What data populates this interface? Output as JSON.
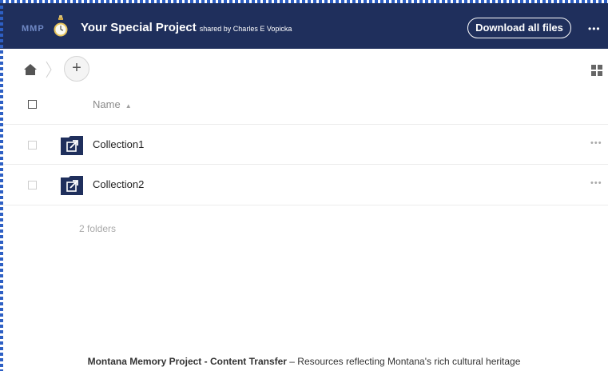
{
  "header": {
    "logo_text": "MMP",
    "title": "Your Special Project",
    "shared_by": "shared by Charles E Vopicka",
    "download_label": "Download all files",
    "more_label": "•••",
    "logo_icon": "watch-icon"
  },
  "toolbar": {
    "home_icon": "home-icon",
    "add_label": "+",
    "view_icon": "grid-view-icon"
  },
  "list": {
    "column_name": "Name",
    "sort_indicator": "▲",
    "rows": [
      {
        "name": "Collection1",
        "more": "•••",
        "icon": "shared-folder-icon"
      },
      {
        "name": "Collection2",
        "more": "•••",
        "icon": "shared-folder-icon"
      }
    ],
    "count_label": "2 folders"
  },
  "footer": {
    "strong": "Montana Memory Project - Content Transfer",
    "rest": " – Resources reflecting Montana's rich cultural heritage"
  },
  "colors": {
    "header_bg": "#1f2f5c",
    "folder_bg": "#1f2f5c",
    "frame_dots": "#2d5fc4"
  }
}
